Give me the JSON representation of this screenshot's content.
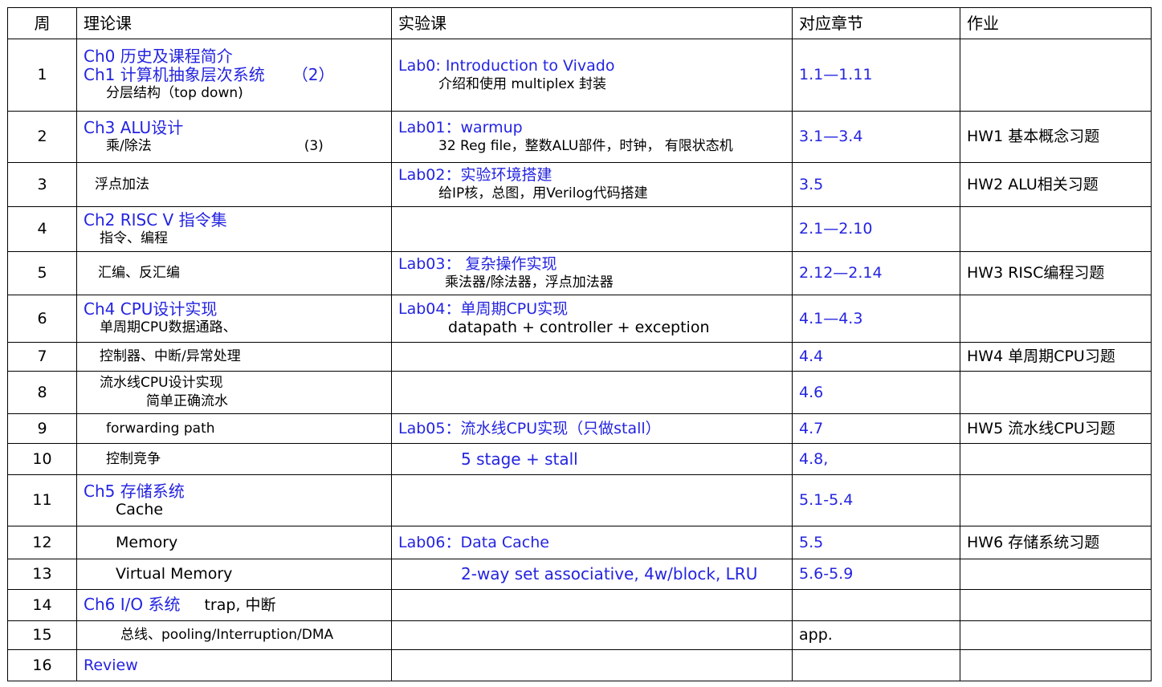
{
  "headers": {
    "week": "周",
    "theory": "理论课",
    "lab": "实验课",
    "chapter": "对应章节",
    "homework": "作业"
  },
  "rows": [
    {
      "week": "1",
      "theory_l1": "Ch0 历史及课程简介",
      "theory_l2": "Ch1 计算机抽象层次系统",
      "theory_l2_note": "（2）",
      "theory_l3": "分层结构（top down)",
      "lab_title": "Lab0: Introduction to Vivado",
      "lab_detail": "介绍和使用 multiplex 封装",
      "chapter": "1.1—1.11",
      "homework": ""
    },
    {
      "week": "2",
      "theory_l1": "Ch3 ALU设计",
      "theory_l2": "乘/除法",
      "theory_l2_note": "(3)",
      "lab_title": "Lab01：warmup",
      "lab_detail": "32 Reg file，整数ALU部件，时钟， 有限状态机",
      "chapter": "3.1—3.4",
      "homework": "HW1 基本概念习题"
    },
    {
      "week": "3",
      "theory_l1": "浮点加法",
      "lab_title": "Lab02：实验环境搭建",
      "lab_detail": "给IP核，总图，用Verilog代码搭建",
      "chapter": "3.5",
      "homework": "HW2  ALU相关习题"
    },
    {
      "week": "4",
      "theory_l1": "Ch2  RISC V 指令集",
      "theory_l2": "指令、编程",
      "lab_title": "",
      "chapter": "2.1—2.10",
      "homework": ""
    },
    {
      "week": "5",
      "theory_l1": "汇编、反汇编",
      "lab_title": "Lab03： 复杂操作实现",
      "lab_detail": "乘法器/除法器，浮点加法器",
      "chapter": "2.12—2.14",
      "homework": "HW3  RISC编程习题"
    },
    {
      "week": "6",
      "theory_l1": "Ch4 CPU设计实现",
      "theory_l2": "单周期CPU数据通路、",
      "lab_title": "Lab04：单周期CPU实现",
      "lab_detail": "datapath + controller + exception",
      "chapter": "4.1—4.3",
      "homework": ""
    },
    {
      "week": "7",
      "theory_l1": "控制器、中断/异常处理",
      "lab_title": "",
      "chapter": "4.4",
      "homework": "HW4  单周期CPU习题"
    },
    {
      "week": "8",
      "theory_l1": "流水线CPU设计实现",
      "theory_l2": "简单正确流水",
      "lab_title": "",
      "chapter": "4.6",
      "homework": ""
    },
    {
      "week": "9",
      "theory_l1": "forwarding path",
      "lab_title": "Lab05：流水线CPU实现（只做stall）",
      "chapter": "4.7",
      "homework": "HW5  流水线CPU习题"
    },
    {
      "week": "10",
      "theory_l1": "控制竞争",
      "lab_title": "5 stage + stall",
      "chapter": "4.8,",
      "homework": ""
    },
    {
      "week": "11",
      "theory_l1": "Ch5 存储系统",
      "theory_l2": "Cache",
      "lab_title": "",
      "chapter": "5.1-5.4",
      "homework": ""
    },
    {
      "week": "12",
      "theory_l1": "Memory",
      "lab_title": "Lab06：Data Cache",
      "chapter": "5.5",
      "homework": "HW6  存储系统习题"
    },
    {
      "week": "13",
      "theory_l1": "Virtual Memory",
      "lab_title": "2-way set associative, 4w/block, LRU",
      "chapter": "5.6-5.9",
      "homework": ""
    },
    {
      "week": "14",
      "theory_l1": "Ch6  I/O 系统",
      "theory_l1_extra": "trap, 中断",
      "lab_title": "",
      "chapter": "",
      "homework": ""
    },
    {
      "week": "15",
      "theory_l1": "总线、pooling/Interruption/DMA",
      "lab_title": "",
      "chapter": "app.",
      "homework": ""
    },
    {
      "week": "16",
      "theory_l1": "Review",
      "lab_title": "",
      "chapter": "",
      "homework": ""
    }
  ],
  "colors": {
    "link_blue": "#2424e0",
    "text": "#000000",
    "border": "#000000"
  }
}
